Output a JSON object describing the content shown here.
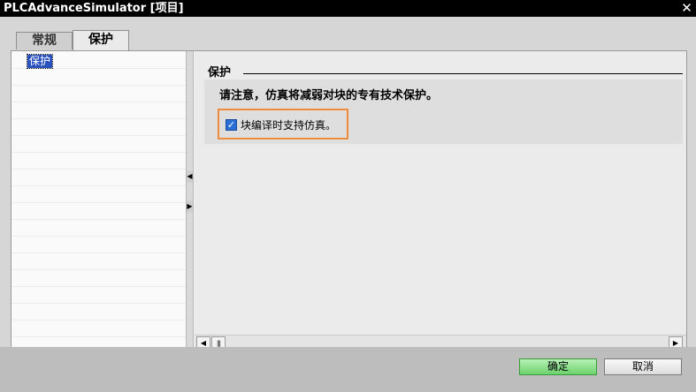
{
  "window": {
    "title": "PLCAdvanceSimulator [项目]",
    "close_glyph": "✕"
  },
  "tabs": [
    {
      "label": "常规",
      "active": false
    },
    {
      "label": "保护",
      "active": true
    }
  ],
  "left_tree": {
    "selected_item": "保护"
  },
  "section": {
    "title": "保护",
    "notice": "请注意，仿真将减弱对块的专有技术保护。",
    "checkbox": {
      "label": "块编译时支持仿真。",
      "checked": true
    }
  },
  "scrollbar": {
    "left_arrow": "◀",
    "right_arrow": "▶",
    "thumb_grip": "|||"
  },
  "splitter": {
    "collapse_arrow": "◀",
    "expand_arrow": "▶"
  },
  "buttons": {
    "ok_label": "确定",
    "cancel_label": "取消"
  },
  "colors": {
    "accent": "#2a52be",
    "highlight": "#f08a3c",
    "ok_button": "#6bd26b"
  }
}
